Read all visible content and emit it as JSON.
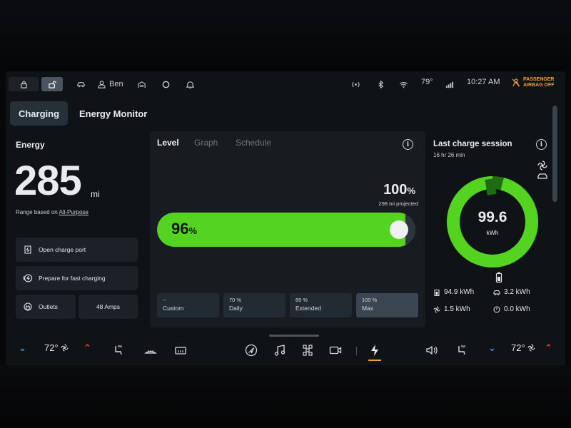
{
  "status_bar": {
    "profile_name": "Ben",
    "temperature": "79°",
    "time": "10:27 AM",
    "airbag_line1": "PASSENGER",
    "airbag_line2": "AIRBAG OFF"
  },
  "tabs": {
    "charging": "Charging",
    "energy_monitor": "Energy Monitor"
  },
  "energy": {
    "title": "Energy",
    "range_value": "285",
    "range_unit": "mi",
    "range_based_label": "Range based on",
    "range_based_mode": "All-Purpose",
    "actions": {
      "open_charge_port": "Open charge port",
      "prepare_fast_charging": "Prepare for fast charging",
      "outlets": "Outlets",
      "amps": "48 Amps"
    }
  },
  "charge_level": {
    "sub_tabs": {
      "level": "Level",
      "graph": "Graph",
      "schedule": "Schedule"
    },
    "current_percent_value": "96",
    "percent_sign": "%",
    "current_fraction": 0.96,
    "limit_percent_value": "100",
    "limit_projection": "298 mi projected",
    "presets": [
      {
        "value": "--",
        "name": "Custom"
      },
      {
        "value": "70 %",
        "name": "Daily"
      },
      {
        "value": "85 %",
        "name": "Extended"
      },
      {
        "value": "100 %",
        "name": "Max"
      }
    ],
    "selected_preset": "Max"
  },
  "session": {
    "title": "Last charge session",
    "duration": "16 hr 26 min",
    "total_kwh": "99.6",
    "total_unit": "kWh",
    "battery_kwh": "94.9 kWh",
    "drive_kwh": "3.2 kWh",
    "climate_kwh": "1.5 kWh",
    "other_kwh": "0.0 kWh",
    "ring_fraction_green": 0.96
  },
  "dock": {
    "left_temp": "72°",
    "right_temp": "72°"
  },
  "colors": {
    "accent_green": "#55d321",
    "down_arrow": "#3f9bff",
    "up_arrow": "#ff4040",
    "airbag_orange": "#f0a030"
  }
}
